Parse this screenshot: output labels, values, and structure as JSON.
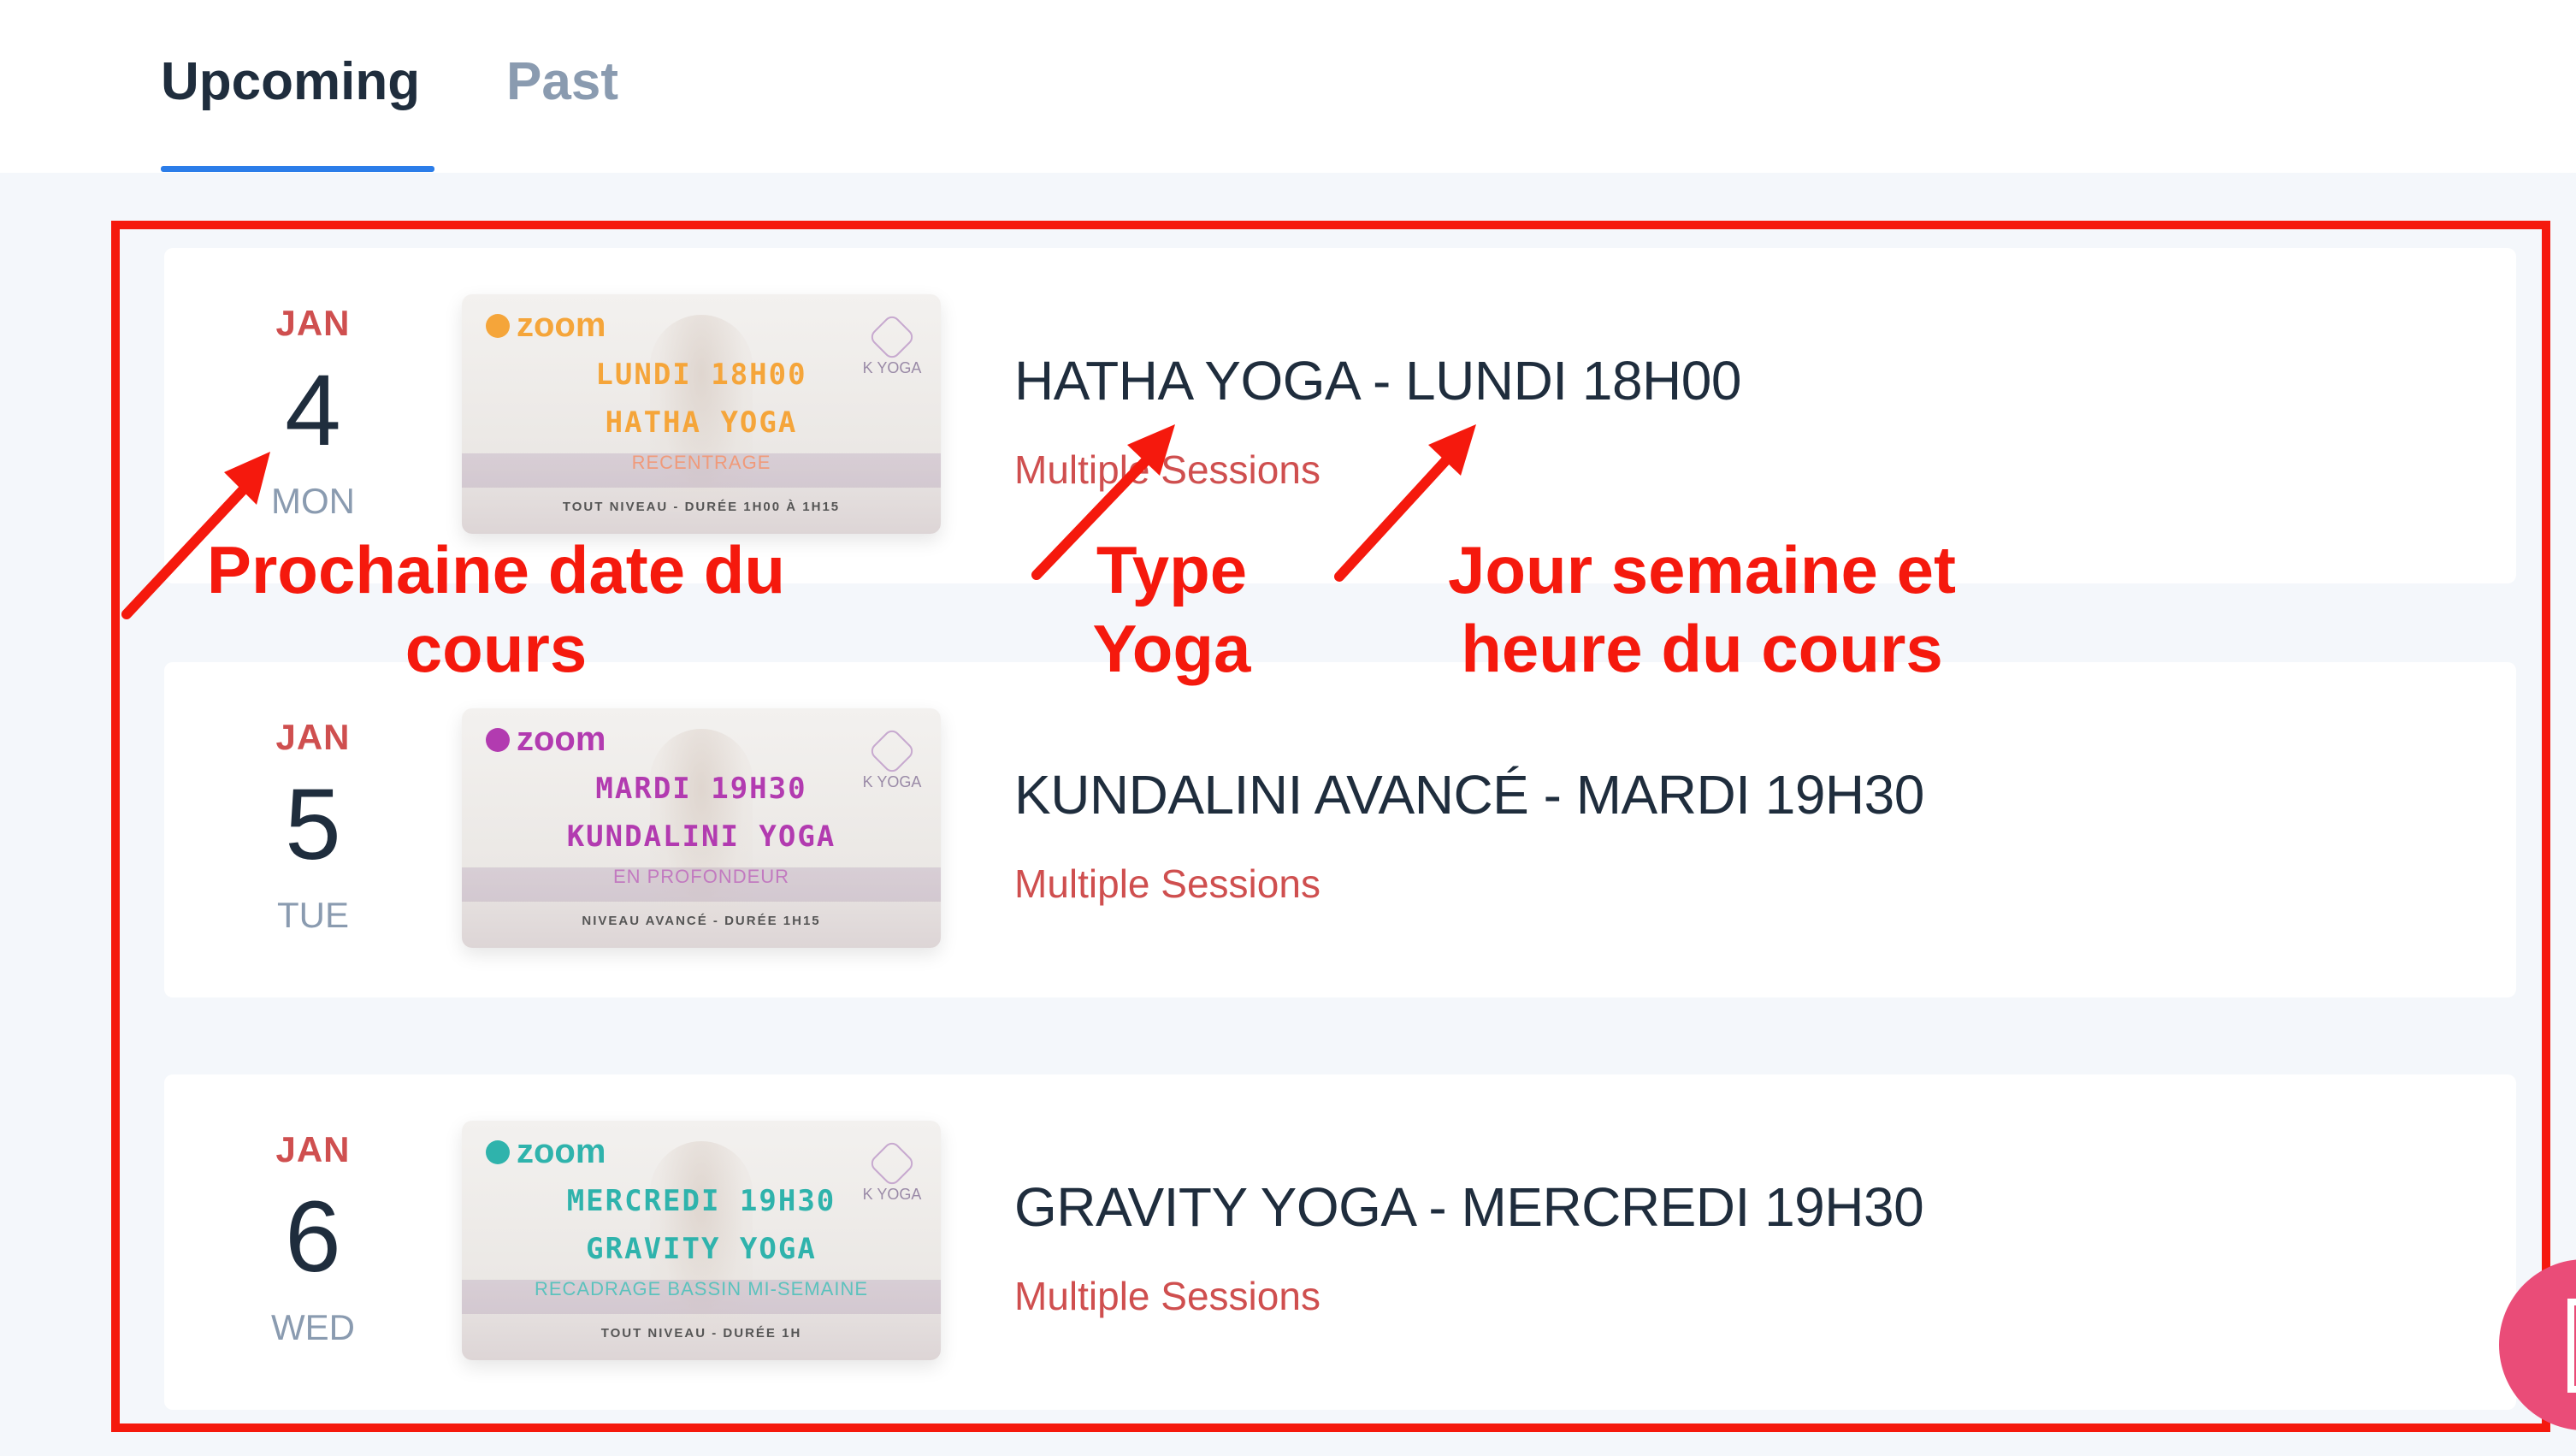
{
  "tabs": {
    "upcoming": "Upcoming",
    "past": "Past",
    "active": "Upcoming",
    "active_color": "#2b7de9"
  },
  "events": [
    {
      "month": "JAN",
      "day": "4",
      "weekday": "MON",
      "title": "HATHA YOGA - LUNDI 18H00",
      "sessions": "Multiple Sessions",
      "thumb": {
        "zoom": "zoom",
        "brand": "K YOGA",
        "line1": "LUNDI 18H00",
        "line2": "HATHA YOGA",
        "sub": "RECENTRAGE",
        "foot": "TOUT NIVEAU - DURÉE 1H00 À 1H15",
        "color": "#f5a53a"
      }
    },
    {
      "month": "JAN",
      "day": "5",
      "weekday": "TUE",
      "title": "KUNDALINI AVANCÉ - MARDI 19H30",
      "sessions": "Multiple Sessions",
      "thumb": {
        "zoom": "zoom",
        "brand": "K YOGA",
        "line1": "MARDI 19H30",
        "line2": "KUNDALINI YOGA",
        "sub": "EN PROFONDEUR",
        "foot": "NIVEAU AVANCÉ - DURÉE 1H15",
        "color": "#b23bb0"
      }
    },
    {
      "month": "JAN",
      "day": "6",
      "weekday": "WED",
      "title": "GRAVITY YOGA - MERCREDI 19H30",
      "sessions": "Multiple Sessions",
      "thumb": {
        "zoom": "zoom",
        "brand": "K YOGA",
        "line1": "MERCREDI 19H30",
        "line2": "GRAVITY YOGA",
        "sub": "RECADRAGE BASSIN MI-SEMAINE",
        "foot": "TOUT NIVEAU - DURÉE 1H",
        "color": "#2fb3ac"
      }
    }
  ],
  "annotations": {
    "date": "Prochaine date du cours",
    "type": "Type Yoga",
    "schedule": "Jour semaine et heure du cours",
    "color": "#f5190d"
  },
  "icons": {
    "chat": "chat-widget-icon",
    "zoom": "zoom-logo-icon",
    "brand": "k-yoga-logo-icon"
  }
}
